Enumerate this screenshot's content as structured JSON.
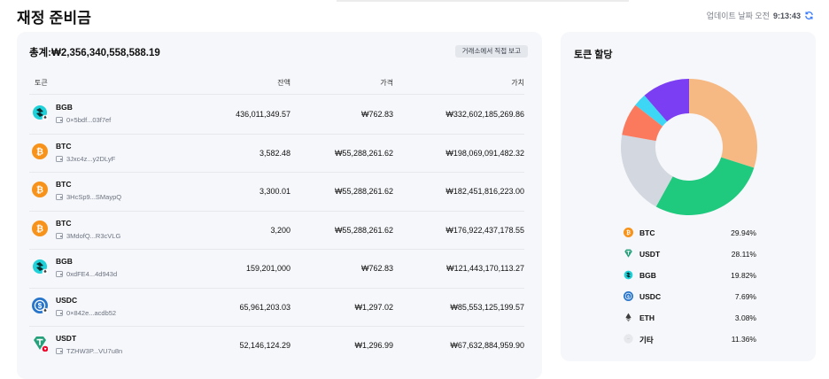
{
  "page": {
    "title": "재정 준비금",
    "updated_label": "업데이트 날짜 오전",
    "updated_time": "9:13:43"
  },
  "reserves": {
    "total_label": "총계:",
    "total_value": "₩2,356,340,558,588.19",
    "exchange_button": "거래소에서 직접 보고",
    "columns": {
      "token": "토큰",
      "balance": "잔액",
      "price": "가격",
      "value": "가치"
    },
    "rows": [
      {
        "symbol": "BGB",
        "address": "0×5bdf...03f7ef",
        "balance": "436,011,349.57",
        "price": "₩762.83",
        "value": "₩332,602,185,269.86",
        "icon": "bgb-icon"
      },
      {
        "symbol": "BTC",
        "address": "3Jxc4z...y2DLyF",
        "balance": "3,582.48",
        "price": "₩55,288,261.62",
        "value": "₩198,069,091,482.32",
        "icon": "btc-icon"
      },
      {
        "symbol": "BTC",
        "address": "3HcSp9...SMaypQ",
        "balance": "3,300.01",
        "price": "₩55,288,261.62",
        "value": "₩182,451,816,223.00",
        "icon": "btc-icon"
      },
      {
        "symbol": "BTC",
        "address": "3MdofQ...R3cVLG",
        "balance": "3,200",
        "price": "₩55,288,261.62",
        "value": "₩176,922,437,178.55",
        "icon": "btc-icon"
      },
      {
        "symbol": "BGB",
        "address": "0xdFE4...4d943d",
        "balance": "159,201,000",
        "price": "₩762.83",
        "value": "₩121,443,170,113.27",
        "icon": "bgb-icon"
      },
      {
        "symbol": "USDC",
        "address": "0×842e...acdb52",
        "balance": "65,961,203.03",
        "price": "₩1,297.02",
        "value": "₩85,553,125,199.57",
        "icon": "usdc-icon"
      },
      {
        "symbol": "USDT",
        "address": "TZHW3P...VU7u8n",
        "balance": "52,146,124.29",
        "price": "₩1,296.99",
        "value": "₩67,632,884,959.90",
        "icon": "usdt-icon"
      }
    ]
  },
  "allocation": {
    "title": "토큰 할당",
    "items": [
      {
        "name": "BTC",
        "pct": "29.94%",
        "value": 29.94,
        "color": "#f6b983",
        "icon": "btc-icon"
      },
      {
        "name": "USDT",
        "pct": "28.11%",
        "value": 28.11,
        "color": "#1fc97e",
        "icon": "usdt-icon"
      },
      {
        "name": "BGB",
        "pct": "19.82%",
        "value": 19.82,
        "color": "#d3d7e0",
        "icon": "bgb-icon"
      },
      {
        "name": "USDC",
        "pct": "7.69%",
        "value": 7.69,
        "color": "#fb7a5e",
        "icon": "usdc-icon"
      },
      {
        "name": "ETH",
        "pct": "3.08%",
        "value": 3.08,
        "color": "#3dd6f5",
        "icon": "eth-icon"
      },
      {
        "name": "기타",
        "pct": "11.36%",
        "value": 11.36,
        "color": "#7b3ef2",
        "icon": "other-icon"
      }
    ]
  }
}
